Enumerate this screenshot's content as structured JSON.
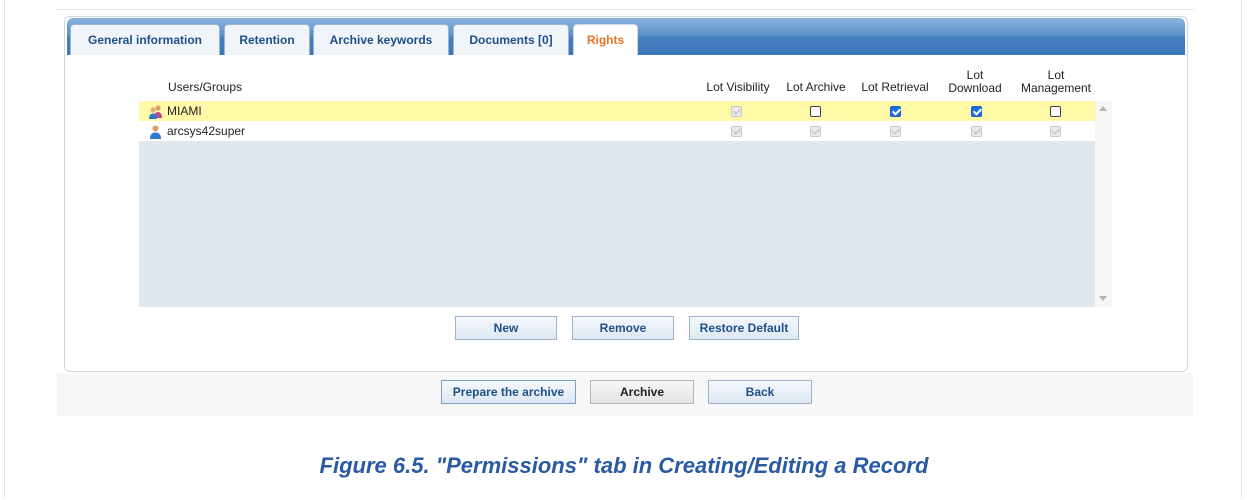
{
  "tabs": [
    {
      "label": "General information",
      "active": false
    },
    {
      "label": "Retention",
      "active": false
    },
    {
      "label": "Archive keywords",
      "active": false
    },
    {
      "label": "Documents [0]",
      "active": false
    },
    {
      "label": "Rights",
      "active": true
    }
  ],
  "table": {
    "columns": {
      "users": "Users/Groups",
      "visibility": "Lot Visibility",
      "archive": "Lot Archive",
      "retrieval": "Lot Retrieval",
      "download_1": "Lot",
      "download_2": "Download",
      "management_1": "Lot",
      "management_2": "Management"
    },
    "rows": [
      {
        "name": "MIAMI",
        "icon": "group-icon",
        "selected": true,
        "visibility": "checked-disabled",
        "archive": "unchecked",
        "retrieval": "checked",
        "download": "checked",
        "management": "unchecked"
      },
      {
        "name": "arcsys42super",
        "icon": "user-icon",
        "selected": false,
        "visibility": "checked-disabled",
        "archive": "checked-disabled",
        "retrieval": "checked-disabled",
        "download": "checked-disabled",
        "management": "checked-disabled"
      }
    ]
  },
  "buttons": {
    "new": "New",
    "remove": "Remove",
    "restore": "Restore Default"
  },
  "footer": {
    "prepare": "Prepare the archive",
    "archive": "Archive",
    "back": "Back"
  },
  "caption": "Figure 6.5. \"Permissions\" tab in Creating/Editing a Record",
  "colors": {
    "accent": "#e8742a",
    "tab_text": "#1f4f86",
    "selected_row": "#fff9a8",
    "caption": "#2a5aa1"
  }
}
